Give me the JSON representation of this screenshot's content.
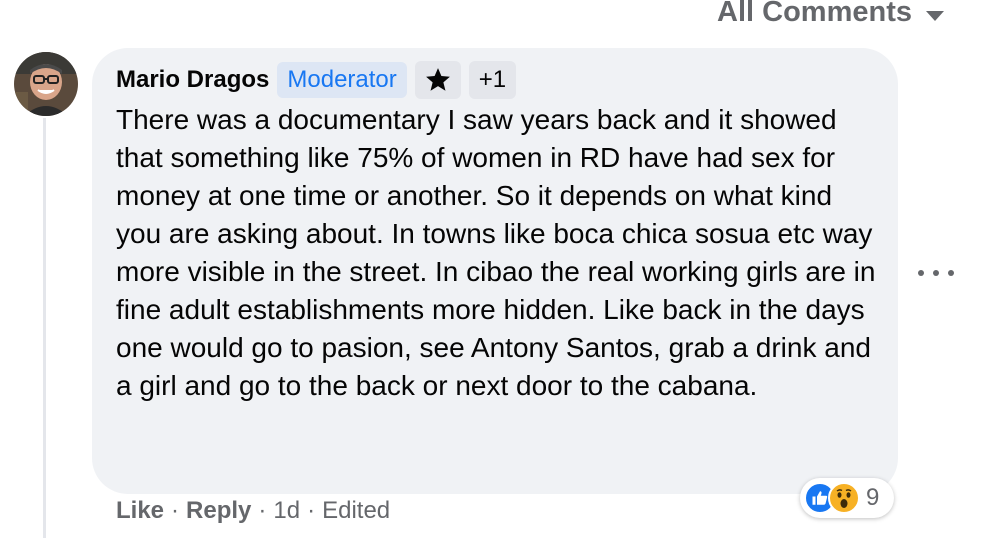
{
  "sort": {
    "label": "All Comments",
    "caret_icon": "caret-down-icon"
  },
  "comment": {
    "author": "Mario Dragos",
    "badge": "Moderator",
    "star_icon": "star-icon",
    "extra_badges": "+1",
    "text": "There was a documentary I saw years back and it showed that something like 75% of women in RD have had sex for money at one time or another. So it depends on what kind you are asking about. In towns like boca chica sosua etc way more visible in the street. In cibao the real working girls are in fine adult establishments more hidden. Like back in the days one would go to pasion, see Antony Santos, grab a drink and a girl and go to the back or next door to the cabana.",
    "reactions": {
      "icons": [
        "like-icon",
        "wow-icon"
      ],
      "count": "9"
    },
    "actions": {
      "like": "Like",
      "reply": "Reply",
      "time": "1d",
      "edited": "Edited",
      "separator": "·"
    },
    "more_icon": "more-options-icon"
  },
  "colors": {
    "bubble": "#f0f2f5",
    "moderator_text": "#1877f2",
    "moderator_bg": "#dde6f4",
    "secondary_text": "#65676b",
    "like_blue": "#1877f2",
    "wow_yellow": "#f7b125"
  }
}
